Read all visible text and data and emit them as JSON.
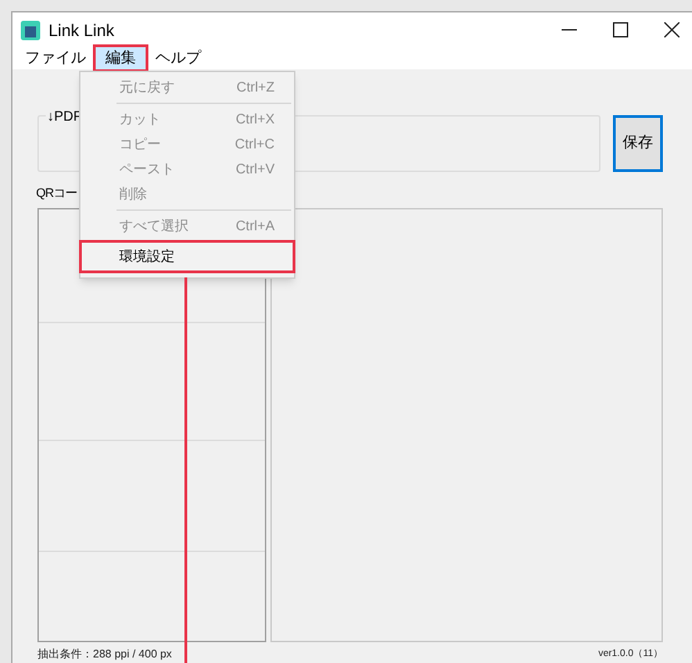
{
  "window": {
    "title": "Link Link"
  },
  "menu_bar": [
    {
      "label": "ファイル",
      "selected": false
    },
    {
      "label": "編集",
      "selected": true
    },
    {
      "label": "ヘルプ",
      "selected": false
    }
  ],
  "edit_menu": [
    {
      "kind": "item",
      "label": "元に戻す",
      "shortcut": "Ctrl+Z",
      "disabled": true,
      "selected": false
    },
    {
      "kind": "separator"
    },
    {
      "kind": "item",
      "label": "カット",
      "shortcut": "Ctrl+X",
      "disabled": true,
      "selected": false
    },
    {
      "kind": "item",
      "label": "コピー",
      "shortcut": "Ctrl+C",
      "disabled": true,
      "selected": false
    },
    {
      "kind": "item",
      "label": "ペースト",
      "shortcut": "Ctrl+V",
      "disabled": true,
      "selected": false
    },
    {
      "kind": "item",
      "label": "削除",
      "disabled": true,
      "selected": false
    },
    {
      "kind": "separator"
    },
    {
      "kind": "item",
      "label": "すべて選択",
      "shortcut": "Ctrl+A",
      "disabled": true,
      "selected": false
    },
    {
      "kind": "item",
      "label": "環境設定",
      "disabled": false,
      "selected": true
    }
  ],
  "pdf_group": {
    "label": "↓PDF"
  },
  "save_button": "保存",
  "qr_label": "QRコー",
  "status_bar": {
    "condition": "抽出条件：288 ppi / 400 px",
    "version": "ver1.0.0（11）"
  }
}
